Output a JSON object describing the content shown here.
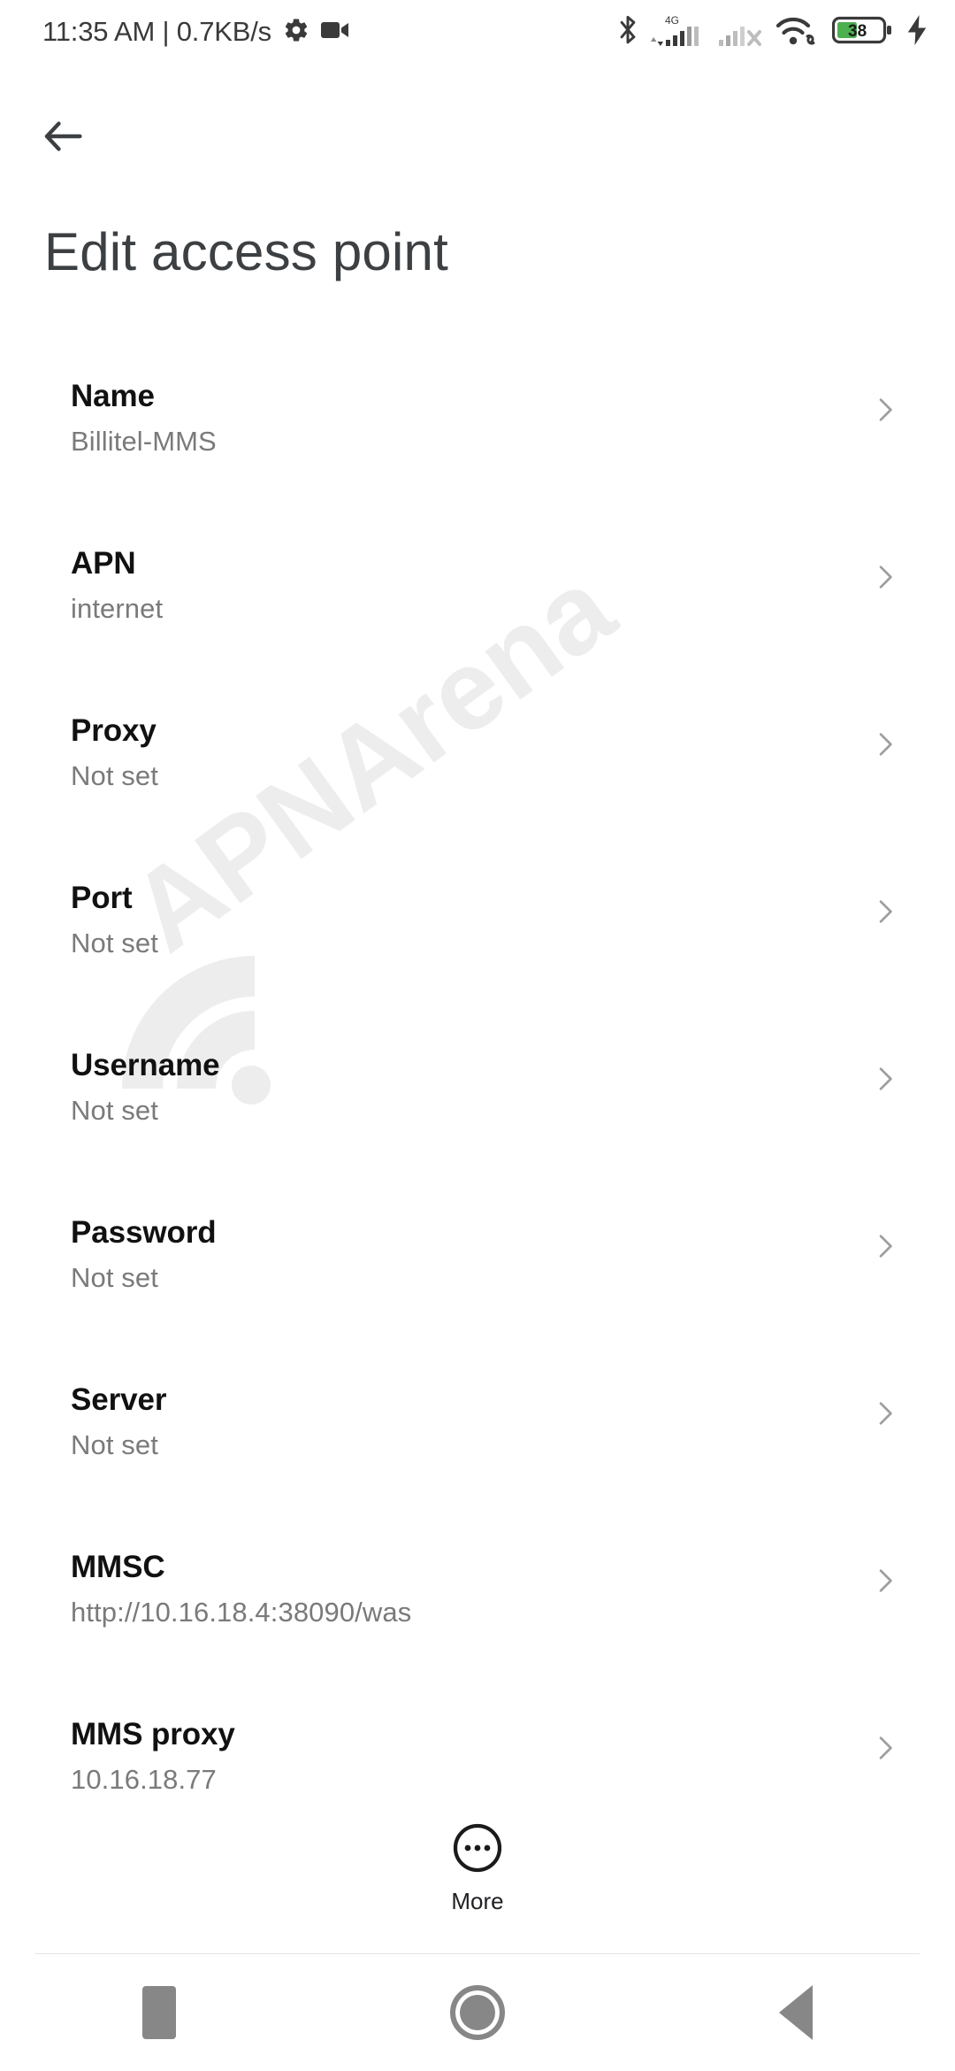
{
  "status_bar": {
    "clock": "11:35 AM | 0.7KB/s",
    "left_icons": [
      "gear-icon",
      "video-camera-icon"
    ],
    "right_icons": [
      "bluetooth-icon",
      "signal-4g-icon",
      "signal-sim2-no-service-icon",
      "wifi-icon",
      "battery-icon",
      "charging-bolt-icon"
    ],
    "network_type": "4G",
    "battery_percent": "38",
    "battery_color": "#4caf50"
  },
  "nav_top": {
    "back_label": "Back"
  },
  "header": {
    "title": "Edit access point"
  },
  "watermark": {
    "text": "APNArena",
    "color": "#ededed"
  },
  "settings": {
    "rows": [
      {
        "title": "Name",
        "value": "Billitel-MMS"
      },
      {
        "title": "APN",
        "value": "internet"
      },
      {
        "title": "Proxy",
        "value": "Not set"
      },
      {
        "title": "Port",
        "value": "Not set"
      },
      {
        "title": "Username",
        "value": "Not set"
      },
      {
        "title": "Password",
        "value": "Not set"
      },
      {
        "title": "Server",
        "value": "Not set"
      },
      {
        "title": "MMSC",
        "value": "http://10.16.18.4:38090/was"
      },
      {
        "title": "MMS proxy",
        "value": "10.16.18.77"
      }
    ]
  },
  "more_button": {
    "label": "More",
    "icon": "more-horiz-circle-icon"
  },
  "nav_bar": {
    "recents_label": "Recents",
    "home_label": "Home",
    "back_label": "Back"
  },
  "colors": {
    "background": "#ffffff",
    "title_text": "#3c4043",
    "row_title_text": "#111111",
    "row_value_text": "#7a7a7a",
    "chevron": "#9e9e9e",
    "nav_icon": "#878787",
    "status_icon": "#3a3a3a"
  }
}
